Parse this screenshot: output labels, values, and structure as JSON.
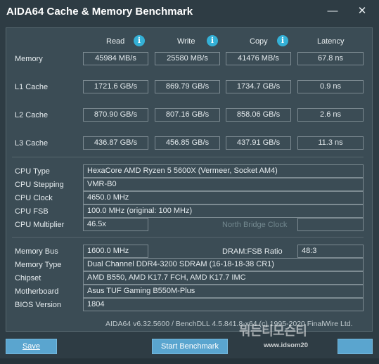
{
  "window": {
    "title": "AIDA64 Cache & Memory Benchmark",
    "minimize_glyph": "—",
    "close_glyph": "✕"
  },
  "columns": {
    "read": "Read",
    "write": "Write",
    "copy": "Copy",
    "latency": "Latency",
    "info_glyph": "i"
  },
  "bench": {
    "memory": {
      "label": "Memory",
      "read": "45984 MB/s",
      "write": "25580 MB/s",
      "copy": "41476 MB/s",
      "latency": "67.8 ns"
    },
    "l1": {
      "label": "L1 Cache",
      "read": "1721.6 GB/s",
      "write": "869.79 GB/s",
      "copy": "1734.7 GB/s",
      "latency": "0.9 ns"
    },
    "l2": {
      "label": "L2 Cache",
      "read": "870.90 GB/s",
      "write": "807.16 GB/s",
      "copy": "858.06 GB/s",
      "latency": "2.6 ns"
    },
    "l3": {
      "label": "L3 Cache",
      "read": "436.87 GB/s",
      "write": "456.85 GB/s",
      "copy": "437.91 GB/s",
      "latency": "11.3 ns"
    }
  },
  "cpu": {
    "type_label": "CPU Type",
    "type": "HexaCore AMD Ryzen 5 5600X  (Vermeer, Socket AM4)",
    "stepping_label": "CPU Stepping",
    "stepping": "VMR-B0",
    "clock_label": "CPU Clock",
    "clock": "4650.0 MHz",
    "fsb_label": "CPU FSB",
    "fsb": "100.0 MHz  (original: 100 MHz)",
    "multiplier_label": "CPU Multiplier",
    "multiplier": "46.5x",
    "north_bridge_label": "North Bridge Clock"
  },
  "memory_info": {
    "bus_label": "Memory Bus",
    "bus": "1600.0 MHz",
    "dram_ratio_label": "DRAM:FSB Ratio",
    "dram_ratio": "48:3",
    "type_label": "Memory Type",
    "type": "Dual Channel DDR4-3200 SDRAM  (16-18-18-38 CR1)",
    "chipset_label": "Chipset",
    "chipset": "AMD B550, AMD K17.7 FCH, AMD K17.7 IMC",
    "motherboard_label": "Motherboard",
    "motherboard": "Asus TUF Gaming B550M-Plus",
    "bios_label": "BIOS Version",
    "bios": "1804"
  },
  "footer": {
    "version": "AIDA64 v6.32.5600 / BenchDLL 4.5.841.8-x64  (c) 1995-2020 FinalWire Ltd.",
    "save": "Save",
    "start": "Start Benchmark"
  },
  "watermark": {
    "text": "뭐든티모슨티",
    "url": "www.idsom20"
  },
  "colors": {
    "background": "#2e3c44",
    "panel": "#3b4c55",
    "accent_button": "#5aa5cf",
    "info_icon": "#34b0d6"
  }
}
